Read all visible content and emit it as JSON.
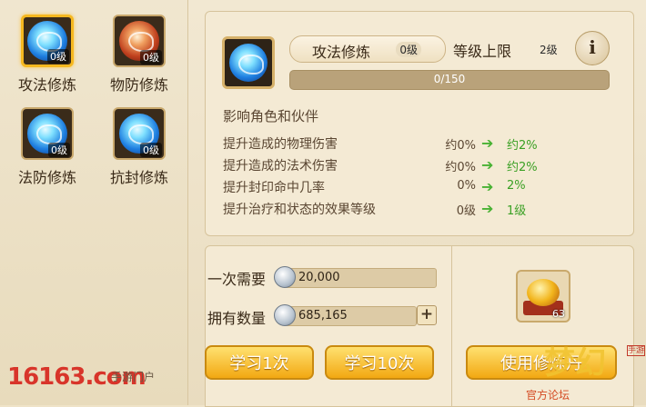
{
  "skills": [
    {
      "label": "攻法修炼",
      "level": "0级",
      "icon": "attack-magic-orb-icon",
      "selected": true
    },
    {
      "label": "物防修炼",
      "level": "0级",
      "icon": "physical-defense-orb-icon",
      "selected": false
    },
    {
      "label": "法防修炼",
      "level": "0级",
      "icon": "magic-defense-orb-icon",
      "selected": false
    },
    {
      "label": "抗封修炼",
      "level": "0级",
      "icon": "seal-resist-orb-icon",
      "selected": false
    }
  ],
  "detail": {
    "name": "攻法修炼",
    "level": "0级",
    "cap_label": "等级上限",
    "cap_value": "2级",
    "info_icon": "i",
    "progress_text": "0/150",
    "progress_fraction": 0,
    "section_title": "影响角色和伙伴",
    "effects": [
      {
        "label": "提升造成的物理伤害",
        "current": "约0%",
        "next": "约2%"
      },
      {
        "label": "提升造成的法术伤害",
        "current": "约0%",
        "next": "约2%"
      },
      {
        "label": "提升封印命中几率",
        "current": "0%",
        "next": "2%"
      },
      {
        "label": "提升治疗和状态的效果等级",
        "current": "0级",
        "next": "1级"
      }
    ],
    "arrow_icon": "➔"
  },
  "cost": {
    "need_label": "一次需要",
    "need_value": "20,000",
    "own_label": "拥有数量",
    "own_value": "685,165",
    "plus": "+"
  },
  "buttons": {
    "learn_once": "学习1次",
    "learn_ten": "学习10次",
    "use_pill": "使用修炼丹"
  },
  "item": {
    "icon": "cultivation-pill-icon",
    "count": "63"
  },
  "watermarks": {
    "left_logo": "16163.com",
    "left_sub": "手游门户",
    "right_logo": "梦幻",
    "right_tag": "手游",
    "right_sub": "官方论坛"
  },
  "colors": {
    "accent": "#f6b820",
    "positive": "#3aa024",
    "button": "#f2a812"
  }
}
